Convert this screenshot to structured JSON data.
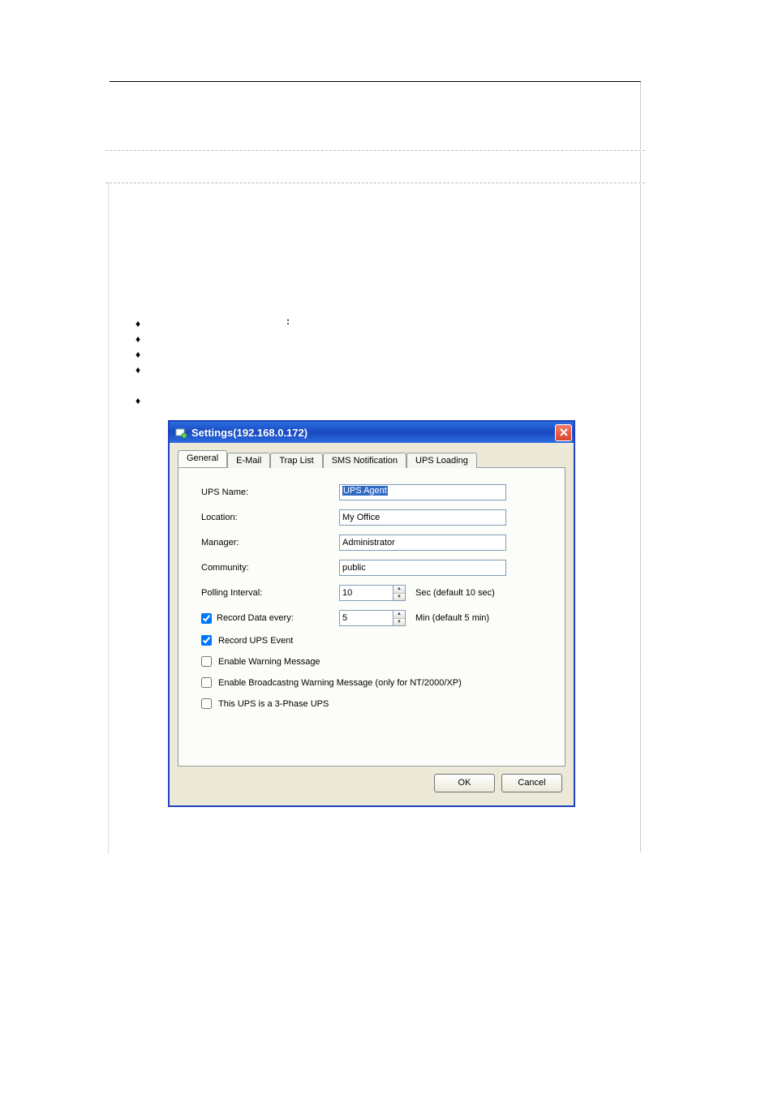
{
  "dialog": {
    "title": "Settings(192.168.0.172)",
    "tabs": [
      "General",
      "E-Mail",
      "Trap List",
      "SMS Notification",
      "UPS Loading"
    ],
    "active_tab": 0,
    "fields": {
      "ups_name_label": "UPS Name:",
      "ups_name_value": "UPS Agent",
      "location_label": "Location:",
      "location_value": "My Office",
      "manager_label": "Manager:",
      "manager_value": "Administrator",
      "community_label": "Community:",
      "community_value": "public",
      "polling_label": "Polling Interval:",
      "polling_value": "10",
      "polling_suffix": "Sec (default 10 sec)",
      "record_data_label": "Record Data every:",
      "record_data_value": "5",
      "record_data_suffix": "Min (default 5 min)"
    },
    "checks": {
      "record_data_checked": true,
      "record_event_label": "Record UPS Event",
      "record_event_checked": true,
      "warn_label": "Enable Warning Message",
      "warn_checked": false,
      "broadcast_label": "Enable Broadcastng Warning Message (only for NT/2000/XP)",
      "broadcast_checked": false,
      "threephase_label": "This UPS is a 3-Phase UPS",
      "threephase_checked": false
    },
    "buttons": {
      "ok": "OK",
      "cancel": "Cancel"
    }
  },
  "bullets": [
    "♦",
    "♦",
    "♦",
    "♦",
    "♦"
  ],
  "colon": ":"
}
